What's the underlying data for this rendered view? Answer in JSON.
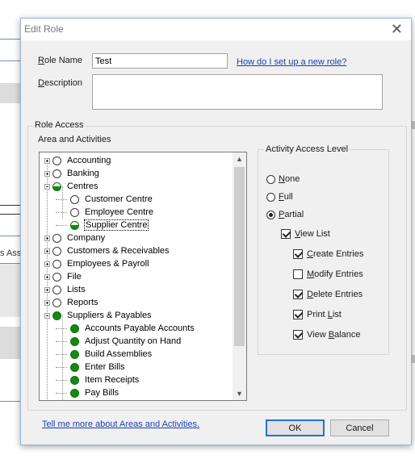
{
  "dialog": {
    "title": "Edit Role"
  },
  "form": {
    "role_name_label": "Role Name",
    "role_name_value": "Test",
    "help_link": "How do I set up a new role?",
    "description_label": "Description",
    "description_value": ""
  },
  "role_access": {
    "group_label": "Role Access",
    "area_label": "Area and Activities",
    "tree": [
      {
        "label": "Accounting",
        "level": 0,
        "state": "none",
        "expander": "plus"
      },
      {
        "label": "Banking",
        "level": 0,
        "state": "none",
        "expander": "plus"
      },
      {
        "label": "Centres",
        "level": 0,
        "state": "partial",
        "expander": "minus"
      },
      {
        "label": "Customer Centre",
        "level": 1,
        "state": "none"
      },
      {
        "label": "Employee Centre",
        "level": 1,
        "state": "none"
      },
      {
        "label": "Supplier Centre",
        "level": 1,
        "state": "partial",
        "selected": true
      },
      {
        "label": "Company",
        "level": 0,
        "state": "none",
        "expander": "plus"
      },
      {
        "label": "Customers & Receivables",
        "level": 0,
        "state": "none",
        "expander": "plus"
      },
      {
        "label": "Employees & Payroll",
        "level": 0,
        "state": "none",
        "expander": "plus"
      },
      {
        "label": "File",
        "level": 0,
        "state": "none",
        "expander": "plus"
      },
      {
        "label": "Lists",
        "level": 0,
        "state": "none",
        "expander": "plus"
      },
      {
        "label": "Reports",
        "level": 0,
        "state": "none",
        "expander": "plus"
      },
      {
        "label": "Suppliers & Payables",
        "level": 0,
        "state": "full",
        "expander": "minus"
      },
      {
        "label": "Accounts Payable Accounts",
        "level": 1,
        "state": "full"
      },
      {
        "label": "Adjust Quantity on Hand",
        "level": 1,
        "state": "full"
      },
      {
        "label": "Build Assemblies",
        "level": 1,
        "state": "full"
      },
      {
        "label": "Enter Bills",
        "level": 1,
        "state": "full"
      },
      {
        "label": "Item Receipts",
        "level": 1,
        "state": "full"
      },
      {
        "label": "Pay Bills",
        "level": 1,
        "state": "full"
      }
    ]
  },
  "activity_access": {
    "group_label": "Activity Access Level",
    "options": [
      {
        "label": "None",
        "underline": "N",
        "rest": "one",
        "selected": false
      },
      {
        "label": "Full",
        "underline": "F",
        "rest": "ull",
        "selected": false
      },
      {
        "label": "Partial",
        "underline": "P",
        "rest": "artial",
        "selected": true
      }
    ],
    "view_list": {
      "label": "View List",
      "pre": "",
      "u": "V",
      "post": "iew List",
      "checked": true
    },
    "sub_options": [
      {
        "label": "Create Entries",
        "pre": "",
        "u": "C",
        "post": "reate Entries",
        "checked": true
      },
      {
        "label": "Modify Entries",
        "pre": "",
        "u": "M",
        "post": "odify Entries",
        "checked": false
      },
      {
        "label": "Delete Entries",
        "pre": "",
        "u": "D",
        "post": "elete Entries",
        "checked": true
      },
      {
        "label": "Print List",
        "pre": "Print ",
        "u": "L",
        "post": "ist",
        "checked": true
      },
      {
        "label": "View Balance",
        "pre": "View ",
        "u": "B",
        "post": "alance",
        "checked": true
      }
    ]
  },
  "footer": {
    "more_link": "Tell me more about Areas and Activities.",
    "ok_label": "OK",
    "cancel_label": "Cancel"
  },
  "background": {
    "fragment_text": "s Ass"
  },
  "colors": {
    "accent_link": "#1a3fb5",
    "full_access": "#138a13",
    "default_button_border": "#2b6fd1"
  }
}
